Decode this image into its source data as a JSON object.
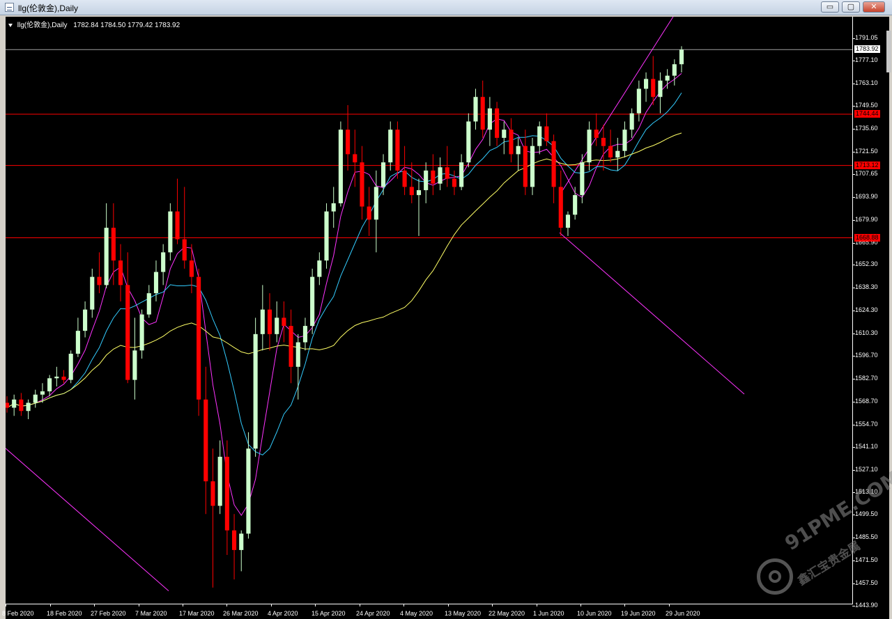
{
  "window": {
    "title": "llg(伦敦金),Daily",
    "buttons": {
      "minimize": "▭",
      "restore": "▢",
      "close": "✕"
    }
  },
  "chart_header": {
    "symbol": "llg(伦敦金),Daily",
    "ohlc": "1782.84 1784.50 1779.42 1783.92"
  },
  "watermark": {
    "site": "91PME.COM",
    "slogan": "鑫汇宝贵金属"
  },
  "colors": {
    "background": "#000000",
    "bull_candle": "#ccffcc",
    "bear_candle": "#ff0000",
    "ma_fast": "#ff33ff",
    "ma_mid": "#33ccff",
    "ma_slow": "#ffff66",
    "channel": "#ff33ff",
    "hlines": "#ff0000"
  },
  "chart_data": {
    "type": "candlestick",
    "title": "llg(伦敦金),Daily",
    "ylim": [
      1443.9,
      1801.5
    ],
    "y_ticks": [
      "1791.05",
      "1777.10",
      "1763.10",
      "1749.50",
      "1735.60",
      "1721.50",
      "1707.65",
      "1693.90",
      "1679.90",
      "1665.90",
      "1652.30",
      "1638.30",
      "1624.30",
      "1610.30",
      "1596.70",
      "1582.70",
      "1568.70",
      "1554.70",
      "1541.10",
      "1527.10",
      "1513.10",
      "1499.50",
      "1485.50",
      "1471.50",
      "1457.50",
      "1443.90"
    ],
    "x_labels": [
      "8 Feb 2020",
      "18 Feb 2020",
      "27 Feb 2020",
      "7 Mar 2020",
      "17 Mar 2020",
      "26 Mar 2020",
      "4 Apr 2020",
      "15 Apr 2020",
      "24 Apr 2020",
      "4 May 2020",
      "13 May 2020",
      "22 May 2020",
      "1 Jun 2020",
      "10 Jun 2020",
      "19 Jun 2020",
      "29 Jun 2020"
    ],
    "current_price": "1783.92",
    "horizontal_levels": [
      "1744.44",
      "1713.12",
      "1668.88"
    ],
    "candles": [
      [
        1568,
        1572,
        1562,
        1565
      ],
      [
        1565,
        1573,
        1560,
        1570
      ],
      [
        1570,
        1574,
        1560,
        1563
      ],
      [
        1563,
        1570,
        1558,
        1568
      ],
      [
        1568,
        1576,
        1565,
        1573
      ],
      [
        1573,
        1580,
        1568,
        1575
      ],
      [
        1575,
        1585,
        1572,
        1583
      ],
      [
        1583,
        1590,
        1578,
        1584
      ],
      [
        1584,
        1588,
        1580,
        1582
      ],
      [
        1582,
        1600,
        1580,
        1598
      ],
      [
        1598,
        1620,
        1596,
        1612
      ],
      [
        1612,
        1630,
        1608,
        1625
      ],
      [
        1625,
        1650,
        1620,
        1645
      ],
      [
        1645,
        1660,
        1635,
        1640
      ],
      [
        1640,
        1690,
        1638,
        1675
      ],
      [
        1675,
        1690,
        1640,
        1655
      ],
      [
        1655,
        1665,
        1630,
        1640
      ],
      [
        1640,
        1660,
        1580,
        1582
      ],
      [
        1582,
        1620,
        1570,
        1600
      ],
      [
        1600,
        1625,
        1595,
        1622
      ],
      [
        1622,
        1640,
        1620,
        1635
      ],
      [
        1635,
        1655,
        1630,
        1648
      ],
      [
        1648,
        1665,
        1640,
        1660
      ],
      [
        1660,
        1690,
        1655,
        1685
      ],
      [
        1685,
        1705,
        1665,
        1668
      ],
      [
        1668,
        1700,
        1650,
        1655
      ],
      [
        1655,
        1665,
        1635,
        1645
      ],
      [
        1645,
        1650,
        1560,
        1570
      ],
      [
        1570,
        1590,
        1500,
        1520
      ],
      [
        1520,
        1540,
        1455,
        1505
      ],
      [
        1505,
        1545,
        1500,
        1535
      ],
      [
        1535,
        1545,
        1475,
        1490
      ],
      [
        1490,
        1500,
        1460,
        1478
      ],
      [
        1478,
        1490,
        1465,
        1488
      ],
      [
        1488,
        1550,
        1485,
        1540
      ],
      [
        1540,
        1620,
        1535,
        1610
      ],
      [
        1610,
        1640,
        1600,
        1625
      ],
      [
        1625,
        1635,
        1600,
        1610
      ],
      [
        1610,
        1630,
        1605,
        1620
      ],
      [
        1620,
        1630,
        1605,
        1615
      ],
      [
        1615,
        1625,
        1580,
        1590
      ],
      [
        1590,
        1610,
        1570,
        1605
      ],
      [
        1605,
        1620,
        1600,
        1615
      ],
      [
        1615,
        1650,
        1610,
        1645
      ],
      [
        1645,
        1660,
        1640,
        1655
      ],
      [
        1655,
        1690,
        1650,
        1685
      ],
      [
        1685,
        1700,
        1675,
        1690
      ],
      [
        1690,
        1740,
        1688,
        1735
      ],
      [
        1735,
        1750,
        1710,
        1720
      ],
      [
        1720,
        1735,
        1700,
        1715
      ],
      [
        1715,
        1725,
        1680,
        1688
      ],
      [
        1688,
        1700,
        1670,
        1680
      ],
      [
        1680,
        1710,
        1660,
        1700
      ],
      [
        1700,
        1720,
        1695,
        1715
      ],
      [
        1715,
        1740,
        1710,
        1735
      ],
      [
        1735,
        1740,
        1705,
        1710
      ],
      [
        1710,
        1725,
        1695,
        1700
      ],
      [
        1700,
        1715,
        1690,
        1695
      ],
      [
        1695,
        1705,
        1670,
        1698
      ],
      [
        1698,
        1715,
        1690,
        1710
      ],
      [
        1710,
        1720,
        1695,
        1702
      ],
      [
        1702,
        1718,
        1698,
        1712
      ],
      [
        1712,
        1725,
        1700,
        1705
      ],
      [
        1705,
        1710,
        1695,
        1700
      ],
      [
        1700,
        1720,
        1698,
        1715
      ],
      [
        1715,
        1745,
        1712,
        1740
      ],
      [
        1740,
        1760,
        1735,
        1755
      ],
      [
        1755,
        1765,
        1730,
        1735
      ],
      [
        1735,
        1755,
        1725,
        1748
      ],
      [
        1748,
        1752,
        1725,
        1730
      ],
      [
        1730,
        1740,
        1720,
        1735
      ],
      [
        1735,
        1742,
        1715,
        1720
      ],
      [
        1720,
        1730,
        1710,
        1725
      ],
      [
        1725,
        1735,
        1695,
        1700
      ],
      [
        1700,
        1730,
        1695,
        1725
      ],
      [
        1725,
        1740,
        1720,
        1737
      ],
      [
        1737,
        1745,
        1725,
        1728
      ],
      [
        1728,
        1732,
        1690,
        1700
      ],
      [
        1700,
        1710,
        1670,
        1675
      ],
      [
        1675,
        1685,
        1670,
        1683
      ],
      [
        1683,
        1700,
        1680,
        1695
      ],
      [
        1695,
        1720,
        1690,
        1715
      ],
      [
        1715,
        1740,
        1710,
        1735
      ],
      [
        1735,
        1745,
        1725,
        1730
      ],
      [
        1730,
        1738,
        1710,
        1725
      ],
      [
        1725,
        1735,
        1715,
        1718
      ],
      [
        1718,
        1730,
        1710,
        1722
      ],
      [
        1722,
        1740,
        1718,
        1735
      ],
      [
        1735,
        1748,
        1730,
        1745
      ],
      [
        1745,
        1765,
        1740,
        1760
      ],
      [
        1760,
        1770,
        1752,
        1766
      ],
      [
        1766,
        1780,
        1750,
        1755
      ],
      [
        1755,
        1770,
        1745,
        1765
      ],
      [
        1765,
        1772,
        1760,
        1768
      ],
      [
        1768,
        1778,
        1762,
        1775
      ],
      [
        1775,
        1786,
        1770,
        1783.92
      ]
    ]
  }
}
